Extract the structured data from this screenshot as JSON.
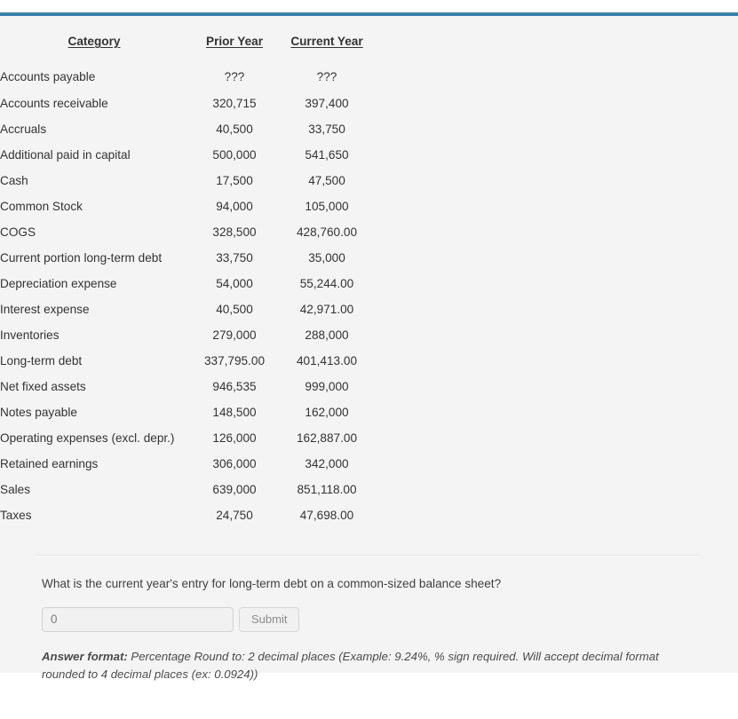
{
  "theme": {
    "accent_bar_color": "#3b7fab",
    "panel_background": "#f4f4f4",
    "text_color": "#333333"
  },
  "table": {
    "headers": {
      "category": "Category",
      "prior_year": "Prior Year",
      "current_year": "Current Year"
    },
    "rows": [
      {
        "category": "Accounts payable",
        "prior": "???",
        "current": "???"
      },
      {
        "category": "Accounts receivable",
        "prior": "320,715",
        "current": "397,400"
      },
      {
        "category": "Accruals",
        "prior": "40,500",
        "current": "33,750"
      },
      {
        "category": "Additional paid in capital",
        "prior": "500,000",
        "current": "541,650"
      },
      {
        "category": "Cash",
        "prior": "17,500",
        "current": "47,500"
      },
      {
        "category": "Common Stock",
        "prior": "94,000",
        "current": "105,000"
      },
      {
        "category": "COGS",
        "prior": "328,500",
        "current": "428,760.00"
      },
      {
        "category": "Current portion long-term debt",
        "prior": "33,750",
        "current": "35,000"
      },
      {
        "category": "Depreciation expense",
        "prior": "54,000",
        "current": "55,244.00"
      },
      {
        "category": "Interest expense",
        "prior": "40,500",
        "current": "42,971.00"
      },
      {
        "category": "Inventories",
        "prior": "279,000",
        "current": "288,000"
      },
      {
        "category": "Long-term debt",
        "prior": "337,795.00",
        "current": "401,413.00"
      },
      {
        "category": "Net fixed assets",
        "prior": "946,535",
        "current": "999,000"
      },
      {
        "category": "Notes payable",
        "prior": "148,500",
        "current": "162,000"
      },
      {
        "category": "Operating expenses (excl. depr.)",
        "prior": "126,000",
        "current": "162,887.00"
      },
      {
        "category": "Retained earnings",
        "prior": "306,000",
        "current": "342,000"
      },
      {
        "category": "Sales",
        "prior": "639,000",
        "current": "851,118.00"
      },
      {
        "category": "Taxes",
        "prior": "24,750",
        "current": "47,698.00"
      }
    ]
  },
  "question": {
    "text": "What is the current year's entry for long-term debt on a common-sized balance sheet?",
    "answer_value": "0",
    "answer_placeholder": "0",
    "submit_label": "Submit",
    "format_label": "Answer format:",
    "format_text": " Percentage Round to: 2 decimal places (Example: 9.24%, % sign required. Will accept decimal format rounded to 4 decimal places (ex: 0.0924))"
  }
}
